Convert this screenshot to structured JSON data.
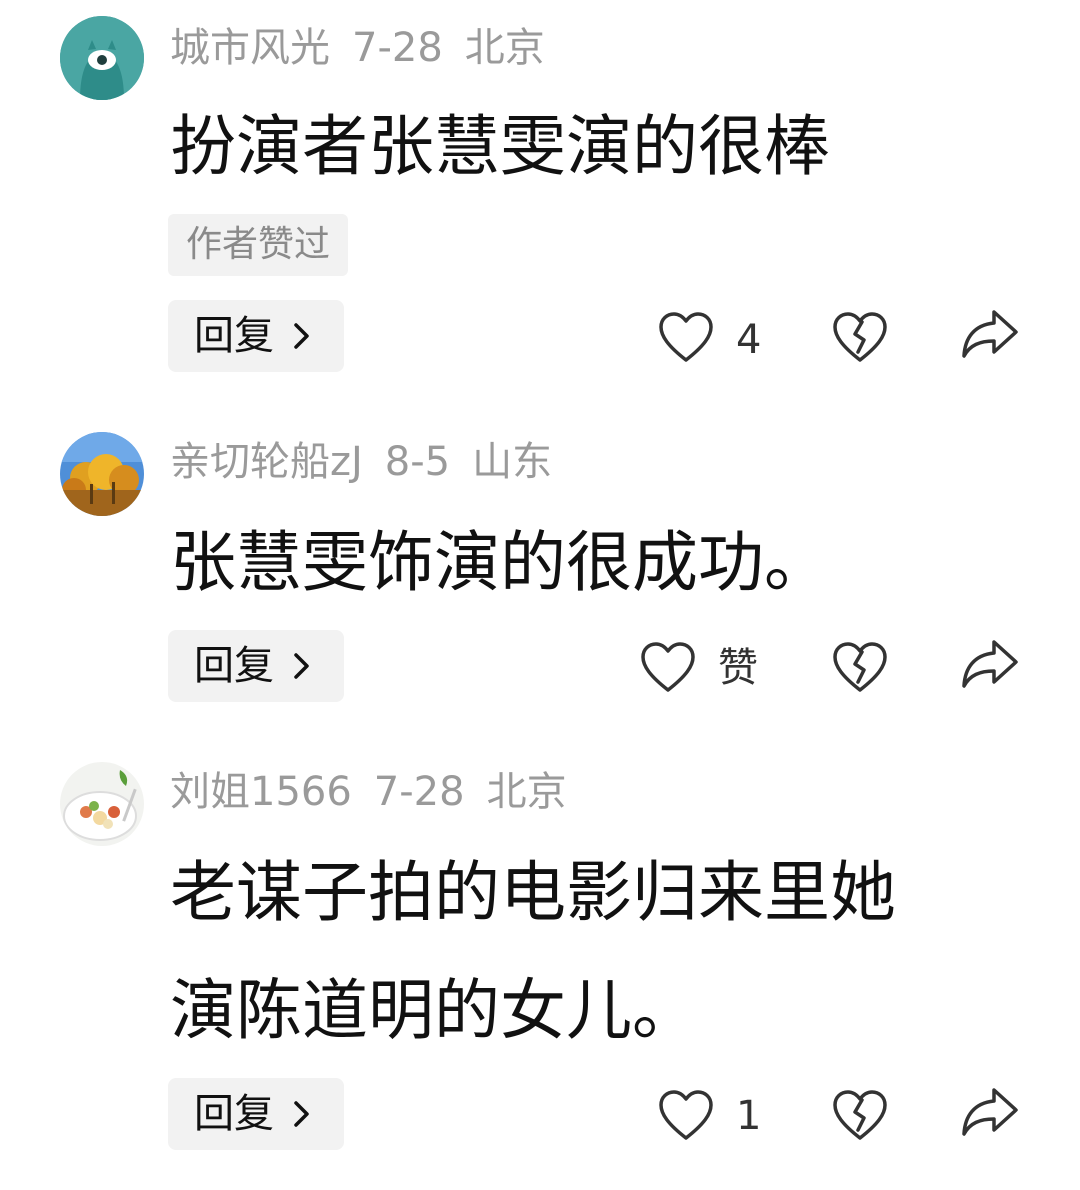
{
  "comments": [
    {
      "username": "城市风光",
      "date": "7-28",
      "location": "北京",
      "lines": [
        "扮演者张慧雯演的很棒"
      ],
      "tag": "作者赞过",
      "reply_label": "回复",
      "like_count": "4",
      "avatar": "teal-cartoon-avatar"
    },
    {
      "username": "亲切轮船zJ",
      "date": "8-5",
      "location": "山东",
      "lines": [
        "张慧雯饰演的很成功。"
      ],
      "reply_label": "回复",
      "like_count": "赞",
      "avatar": "autumn-trees-avatar"
    },
    {
      "username": "刘姐1566",
      "date": "7-28",
      "location": "北京",
      "lines": [
        "老谋子拍的电影归来里她",
        "演陈道明的女儿。"
      ],
      "reply_label": "回复",
      "like_count": "1",
      "avatar": "salad-plate-avatar"
    }
  ],
  "icons": {
    "like": "heart-outline-icon",
    "dislike": "broken-heart-icon",
    "share": "share-arrow-icon",
    "reply_chevron": "chevron-right-icon"
  },
  "colors": {
    "meta_text": "#9a9a9a",
    "body_text": "#111111",
    "chip_bg": "#f2f2f2",
    "icon_stroke": "#333333"
  }
}
